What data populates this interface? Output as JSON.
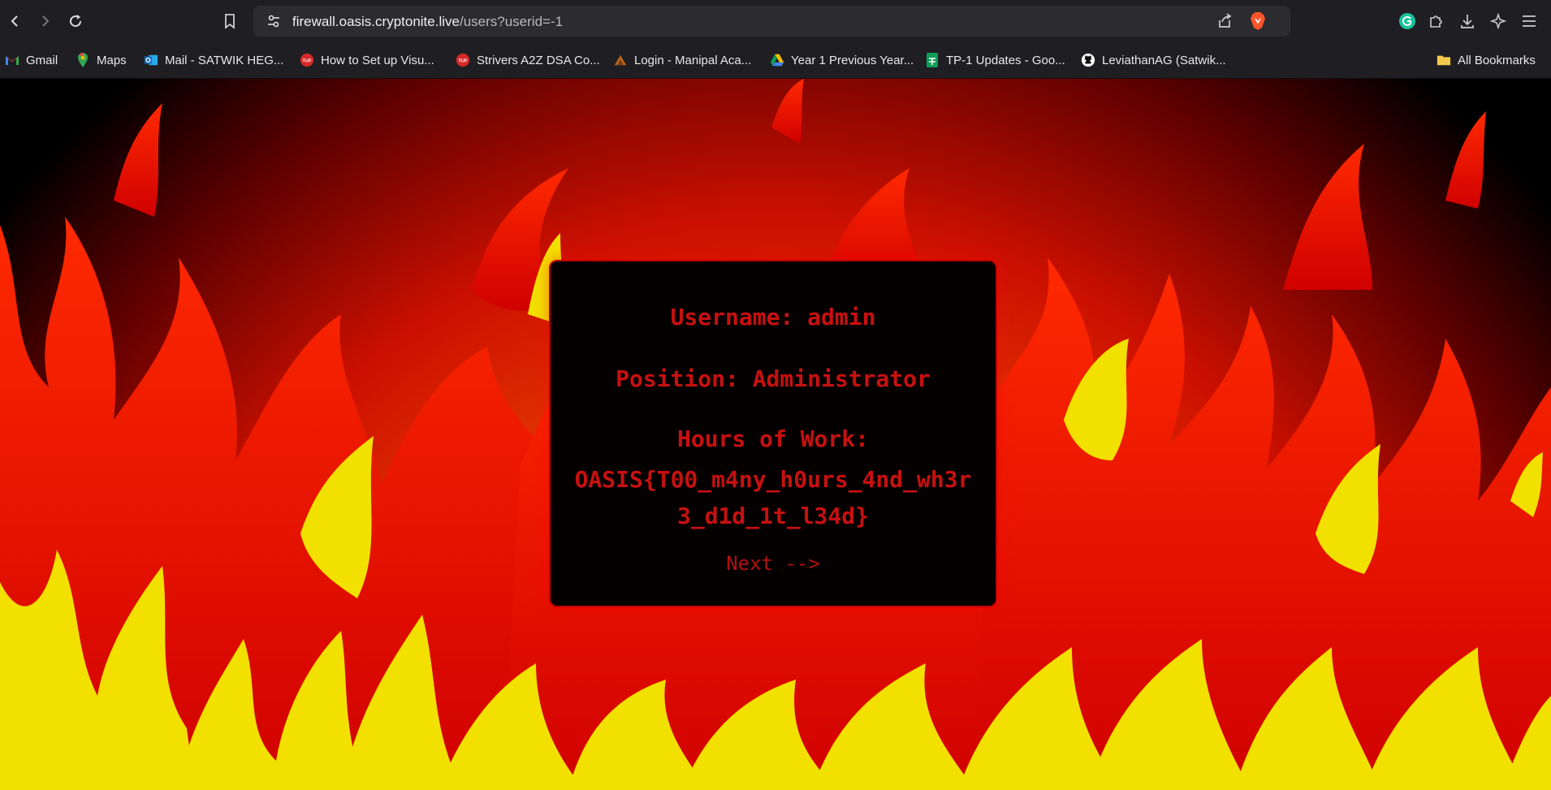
{
  "browser": {
    "url_host": "firewall.oasis.cryptonite.live",
    "url_path": "/users?userid=-1",
    "bookmarks": [
      {
        "label": "Gmail",
        "icon": "gmail-icon"
      },
      {
        "label": "Maps",
        "icon": "maps-icon"
      },
      {
        "label": "Mail - SATWIK HEG...",
        "icon": "outlook-icon"
      },
      {
        "label": "How to Set up Visu...",
        "icon": "tuf-icon"
      },
      {
        "label": "Strivers A2Z DSA Co...",
        "icon": "tuf-icon"
      },
      {
        "label": "Login - Manipal Aca...",
        "icon": "manipal-icon"
      },
      {
        "label": "Year 1 Previous Year...",
        "icon": "drive-icon"
      },
      {
        "label": "TP-1 Updates - Goo...",
        "icon": "sheets-icon"
      },
      {
        "label": "LeviathanAG (Satwik...",
        "icon": "github-icon"
      }
    ],
    "all_bookmarks": "All Bookmarks"
  },
  "card": {
    "username": "Username: admin",
    "position": "Position: Administrator",
    "hours_label": "Hours of Work:",
    "flag": "OASIS{T00_m4ny_h0urs_4nd_wh3r3_d1d_1t_l34d}",
    "next": "Next -->"
  },
  "colors": {
    "accent": "#c81010",
    "flame_red": "#e01000",
    "flame_yellow": "#f2e000"
  }
}
